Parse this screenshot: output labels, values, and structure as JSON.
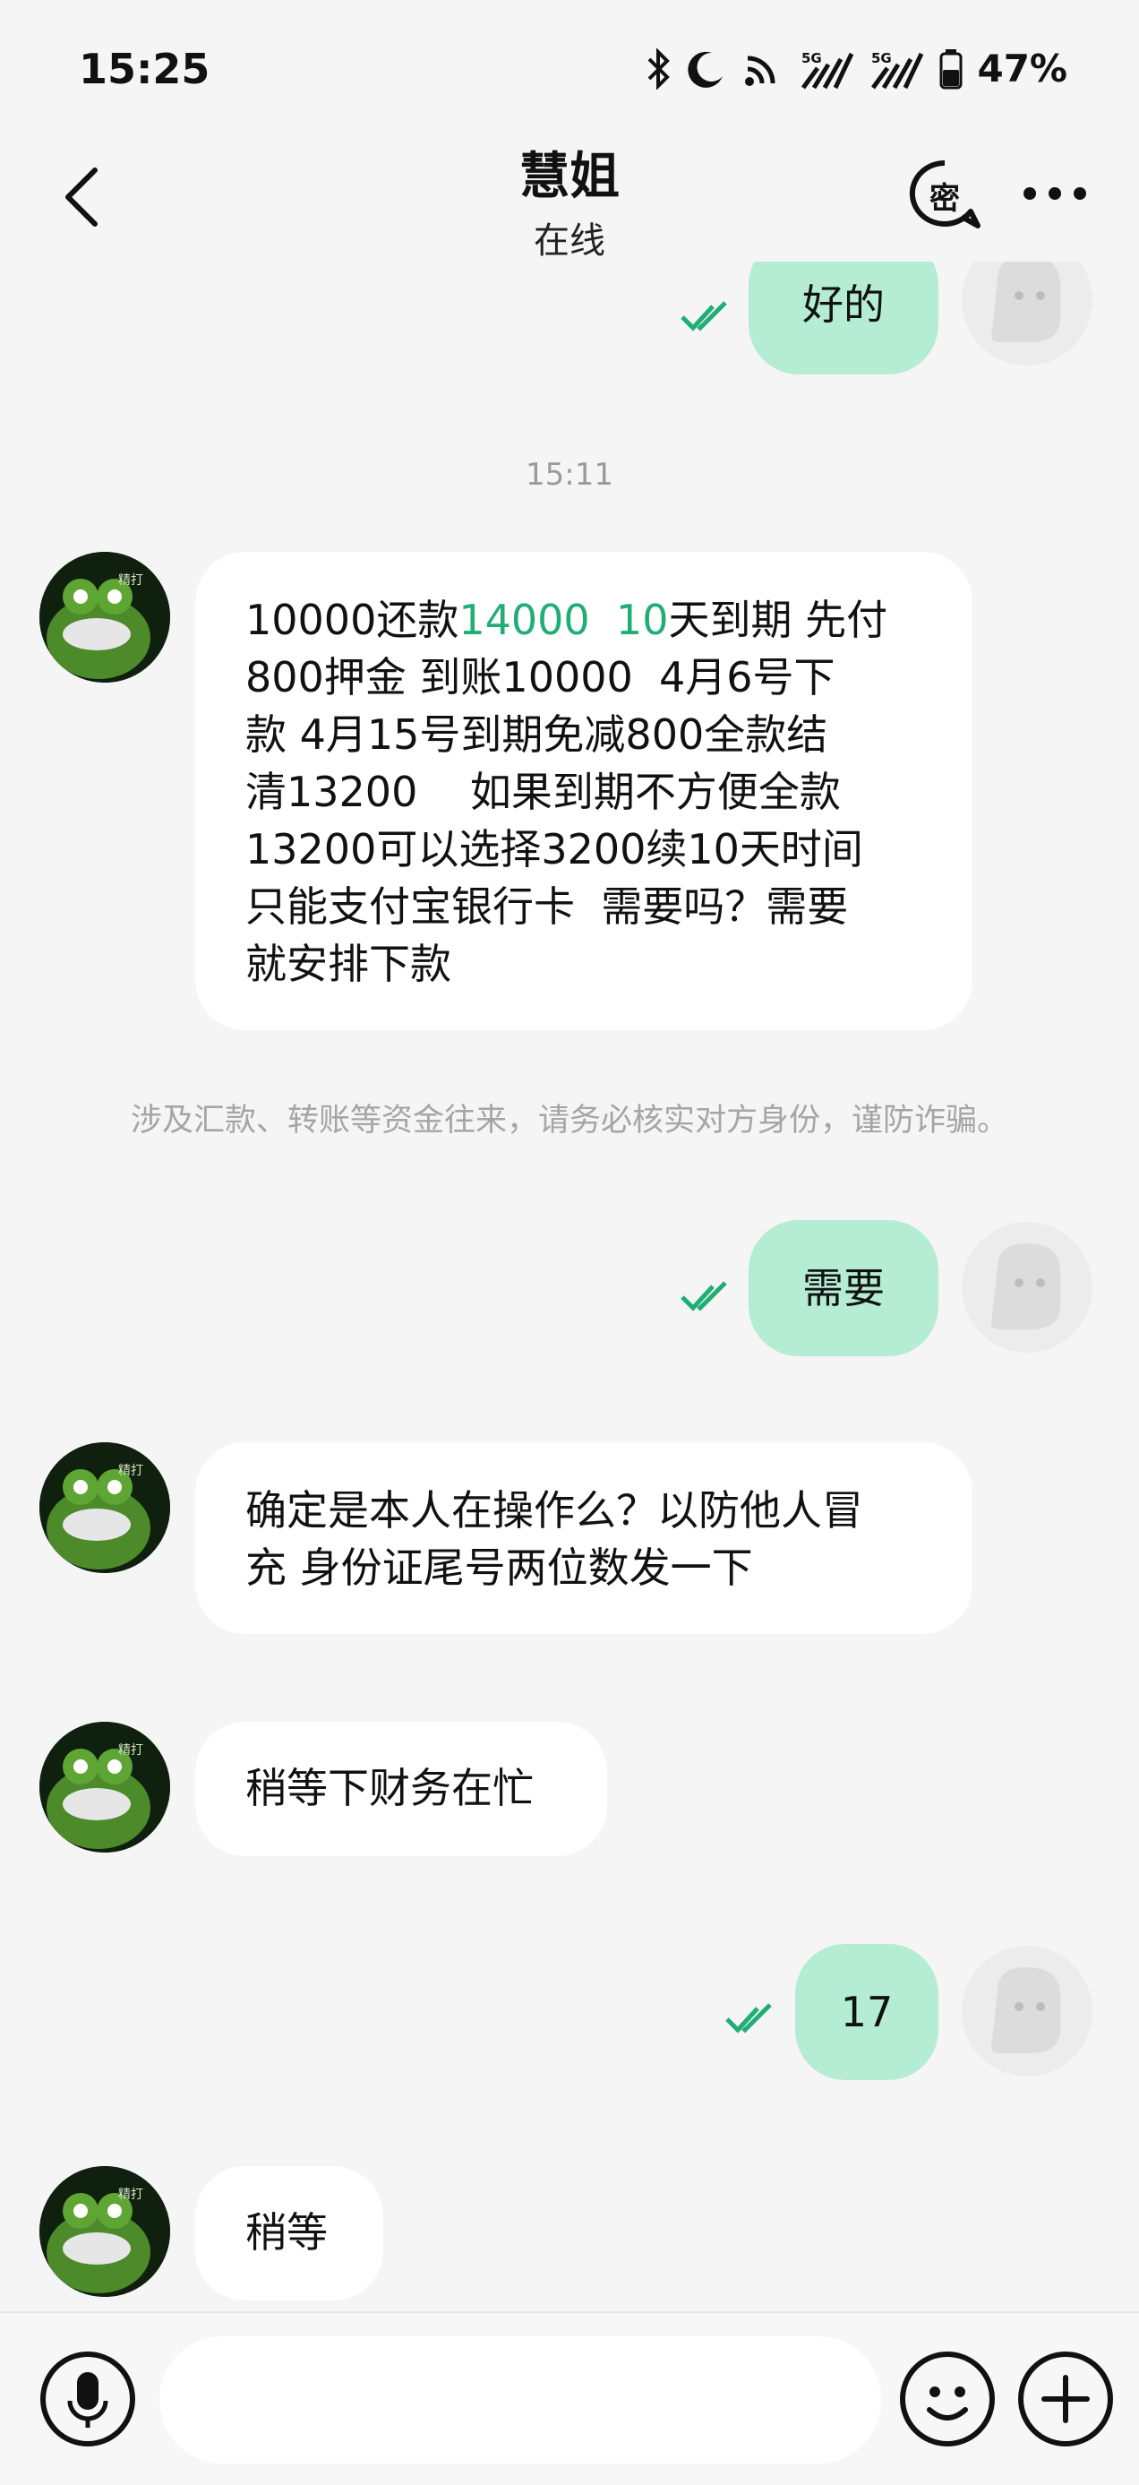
{
  "status_bar": {
    "time": "15:25",
    "icons": [
      "bluetooth-icon",
      "moon-icon",
      "wifi-icon",
      "signal-5g-icon",
      "signal-5g-icon",
      "battery-icon"
    ],
    "battery": "47%"
  },
  "header": {
    "title": "慧姐",
    "subtitle": "在线",
    "secret_label": "密"
  },
  "messages": {
    "m1": "好的",
    "timestamp": "15:11",
    "m2_parts": [
      "10000还款",
      "14000  10",
      "天到期 先付\n800押金 到账10000  4月6号下\n款 4月15号到期免减800全款结\n清13200    如果到期不方便全款\n13200可以选择3200续10天时间\n只能支付宝银行卡  需要吗？需要\n就安排下款"
    ],
    "warning": "涉及汇款、转账等资金往来，请务必核实对方身份，谨防诈骗。",
    "m3": "需要",
    "m4": "确定是本人在操作么？以防他人冒\n充 身份证尾号两位数发一下",
    "m5": "稍等下财务在忙",
    "m6": "17",
    "m7": "稍等"
  },
  "colors": {
    "outgoing_bubble": "#b4ecd4",
    "incoming_bubble": "#ffffff",
    "accent_green": "#1fae73",
    "background": "#f5f5f5"
  }
}
